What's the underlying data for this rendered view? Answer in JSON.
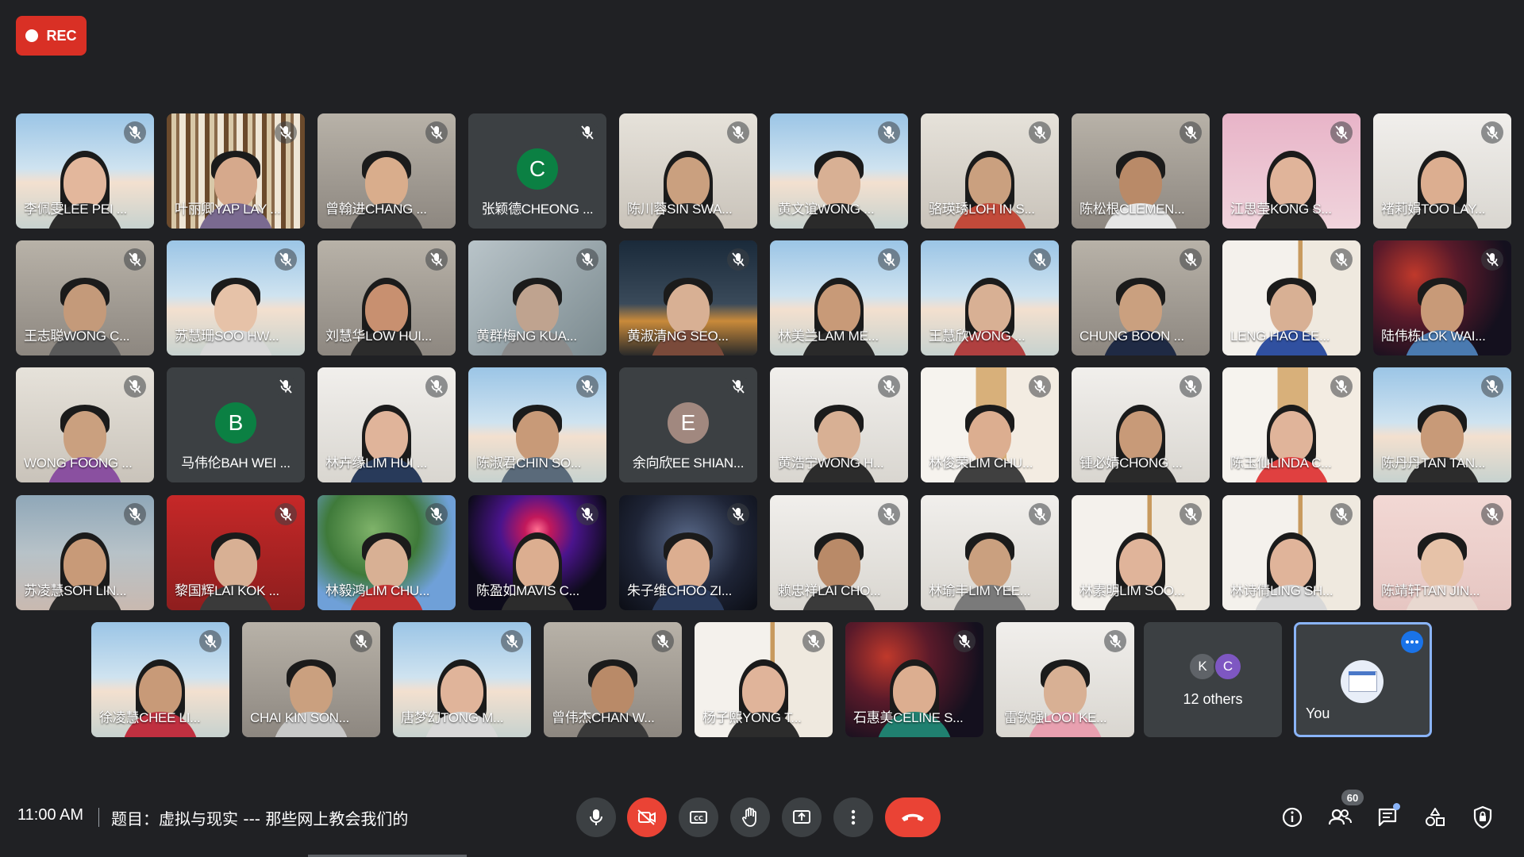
{
  "recording": {
    "label": "REC"
  },
  "participants": [
    {
      "name": "李佩雯LEE PEI ...",
      "kind": "video",
      "bg": "beach",
      "skin": "#e3b79c",
      "shirt": "#2c2c2c",
      "long_hair": true
    },
    {
      "name": "叶丽卿YAP LAY ...",
      "kind": "video",
      "bg": "books",
      "skin": "#d6a98c",
      "shirt": "#7a6a90",
      "long_hair": false
    },
    {
      "name": "曾翰进CHANG ...",
      "kind": "video",
      "bg": "room",
      "skin": "#d9ad8c",
      "shirt": "#3a3a3a",
      "long_hair": false
    },
    {
      "name": "张颖德CHEONG ...",
      "kind": "avatar",
      "letter": "C",
      "avatar_color": "#0b8043"
    },
    {
      "name": "陈川蓉SIN SWA...",
      "kind": "video",
      "bg": "room_light",
      "skin": "#caa07f",
      "shirt": "#2c2c2c",
      "long_hair": true
    },
    {
      "name": "黄文谊WONG ...",
      "kind": "video",
      "bg": "beach",
      "skin": "#d8b094",
      "shirt": "#2a2a2a",
      "long_hair": false
    },
    {
      "name": "骆瑛琇LOH IN S...",
      "kind": "video",
      "bg": "room_light",
      "skin": "#caa07f",
      "shirt": "#c24a3a",
      "long_hair": true
    },
    {
      "name": "陈松根CLEMEN...",
      "kind": "video",
      "bg": "room",
      "skin": "#b98a68",
      "shirt": "#e6e6e6",
      "long_hair": false
    },
    {
      "name": "江思莹KONG S...",
      "kind": "video",
      "bg": "pink",
      "skin": "#e0b49a",
      "shirt": "#2b2b2b",
      "long_hair": true
    },
    {
      "name": "褚莉娟TOO LAY...",
      "kind": "video",
      "bg": "white",
      "skin": "#dcae90",
      "shirt": "#2c2c2c",
      "long_hair": true
    },
    {
      "name": "王志聪WONG C...",
      "kind": "video",
      "bg": "room",
      "skin": "#c49a7a",
      "shirt": "#5a5a5a",
      "long_hair": false
    },
    {
      "name": "苏慧珊SOO HW...",
      "kind": "video",
      "bg": "beach",
      "skin": "#e6c2a8",
      "shirt": "#d8d8d8",
      "long_hair": false
    },
    {
      "name": "刘慧华LOW HUI...",
      "kind": "video",
      "bg": "room",
      "skin": "#c89070",
      "shirt": "#2c2c2c",
      "long_hair": true
    },
    {
      "name": "黄群梅NG KUA...",
      "kind": "video",
      "bg": "blur",
      "skin": "#bfa38f",
      "shirt": "#8a8a8a",
      "long_hair": false
    },
    {
      "name": "黄淑清NG SEO...",
      "kind": "video",
      "bg": "night",
      "skin": "#d8b094",
      "shirt": "#7a4a3a",
      "long_hair": false
    },
    {
      "name": "林美兰LAM ME...",
      "kind": "video",
      "bg": "beach",
      "skin": "#c89a78",
      "shirt": "#2a2a2a",
      "long_hair": true
    },
    {
      "name": "王慧欣WONG ...",
      "kind": "video",
      "bg": "beach",
      "skin": "#d8b094",
      "shirt": "#b04040",
      "long_hair": true
    },
    {
      "name": "CHUNG BOON ...",
      "kind": "video",
      "bg": "room",
      "skin": "#caa07f",
      "shirt": "#1f2a44",
      "long_hair": false
    },
    {
      "name": "LENG HAO EE...",
      "kind": "video",
      "bg": "shelf",
      "skin": "#d8b094",
      "shirt": "#3050a0",
      "long_hair": false
    },
    {
      "name": "陆伟栋LOK WAI...",
      "kind": "video",
      "bg": "space",
      "skin": "#c89a78",
      "shirt": "#4a7ab0",
      "long_hair": false
    },
    {
      "name": "WONG FOONG ...",
      "kind": "video",
      "bg": "room_light",
      "skin": "#caa07f",
      "shirt": "#8a50a0",
      "long_hair": false
    },
    {
      "name": "马伟伦BAH WEI ...",
      "kind": "avatar",
      "letter": "B",
      "avatar_color": "#0b8043"
    },
    {
      "name": "林卉缘LIM HUI ...",
      "kind": "video",
      "bg": "white",
      "skin": "#e0b49a",
      "shirt": "#283a5a",
      "long_hair": true
    },
    {
      "name": "陈淑君CHIN SO...",
      "kind": "video",
      "bg": "beach",
      "skin": "#c89a78",
      "shirt": "#5a6a7a",
      "long_hair": false
    },
    {
      "name": "余向欣EE SHIAN...",
      "kind": "avatar",
      "letter": "E",
      "avatar_color": "#a1887f"
    },
    {
      "name": "黄浩宁WONG H...",
      "kind": "video",
      "bg": "white",
      "skin": "#d8b094",
      "shirt": "#2c2c2c",
      "long_hair": false
    },
    {
      "name": "林俊荣LIM CHU...",
      "kind": "video",
      "bg": "wood",
      "skin": "#dcae90",
      "shirt": "#404040",
      "long_hair": false
    },
    {
      "name": "锺必婧CHONG ...",
      "kind": "video",
      "bg": "white",
      "skin": "#c89a78",
      "shirt": "#2a2a2a",
      "long_hair": true
    },
    {
      "name": "陈玉仙LINDA C...",
      "kind": "video",
      "bg": "wood",
      "skin": "#e0b49a",
      "shirt": "#e04040",
      "long_hair": true
    },
    {
      "name": "陈丹丹TAN TAN...",
      "kind": "video",
      "bg": "beach",
      "skin": "#c89a78",
      "shirt": "#2c2c2c",
      "long_hair": false
    },
    {
      "name": "苏凌慧SOH LIN...",
      "kind": "video",
      "bg": "beach_dim",
      "skin": "#c89a78",
      "shirt": "#2a2a2a",
      "long_hair": true
    },
    {
      "name": "黎国辉LAI KOK ...",
      "kind": "video",
      "bg": "red",
      "skin": "#d8b094",
      "shirt": "#3a3a3a",
      "long_hair": false
    },
    {
      "name": "林毅鸿LIM CHU...",
      "kind": "video",
      "bg": "tree",
      "skin": "#d8b094",
      "shirt": "#c03030",
      "long_hair": false
    },
    {
      "name": "陈盈如MAVIS C...",
      "kind": "video",
      "bg": "fireworks",
      "skin": "#dcae90",
      "shirt": "#2c2c2c",
      "long_hair": true
    },
    {
      "name": "朱子维CHOO ZI...",
      "kind": "video",
      "bg": "dark",
      "skin": "#dcae90",
      "shirt": "#2a3a5a",
      "long_hair": false
    },
    {
      "name": "赖忠祥LAI CHO...",
      "kind": "video",
      "bg": "white",
      "skin": "#b98a68",
      "shirt": "#3a3a3a",
      "long_hair": false
    },
    {
      "name": "林瑜丰LIM YEE...",
      "kind": "video",
      "bg": "white",
      "skin": "#caa07f",
      "shirt": "#7a7a7a",
      "long_hair": false
    },
    {
      "name": "林素明LIM SOO...",
      "kind": "video",
      "bg": "shelf",
      "skin": "#e0b49a",
      "shirt": "#2c2c2c",
      "long_hair": true
    },
    {
      "name": "林诗倩LING SH...",
      "kind": "video",
      "bg": "shelf",
      "skin": "#e0b49a",
      "shirt": "#d8d8d8",
      "long_hair": true
    },
    {
      "name": "陈靖轩TAN JIN...",
      "kind": "video",
      "bg": "pinkwall",
      "skin": "#e6c2a8",
      "shirt": "#e8d8d0",
      "long_hair": false
    },
    {
      "name": "徐凌慧CHEE LI...",
      "kind": "video",
      "bg": "beach",
      "skin": "#c89a78",
      "shirt": "#c03040",
      "long_hair": true
    },
    {
      "name": "CHAI KIN SON...",
      "kind": "video",
      "bg": "room",
      "skin": "#caa07f",
      "shirt": "#c8c8c8",
      "long_hair": false
    },
    {
      "name": "唐梦幻TONG M...",
      "kind": "video",
      "bg": "beach",
      "skin": "#e0b49a",
      "shirt": "#d8d8d8",
      "long_hair": true
    },
    {
      "name": "曾伟杰CHAN W...",
      "kind": "video",
      "bg": "room",
      "skin": "#b98a68",
      "shirt": "#3a3a3a",
      "long_hair": false
    },
    {
      "name": "杨子熙YONG T...",
      "kind": "video",
      "bg": "shelf",
      "skin": "#e0b49a",
      "shirt": "#2c2c2c",
      "long_hair": true
    },
    {
      "name": "石惠美CELINE S...",
      "kind": "video",
      "bg": "space",
      "skin": "#dcae90",
      "shirt": "#208070",
      "long_hair": true
    },
    {
      "name": "雷钦强LOOI KE...",
      "kind": "video",
      "bg": "white",
      "skin": "#d8b094",
      "shirt": "#e8a0b0",
      "long_hair": false
    }
  ],
  "others": {
    "label": "12 others",
    "avatars": [
      {
        "letter": "K",
        "color": "#5f6368"
      },
      {
        "letter": "C",
        "color": "#7e57c2"
      }
    ]
  },
  "self_tile": {
    "label": "You"
  },
  "bottom_bar": {
    "time": "11:00 AM",
    "meeting_title": "题目：虚拟与现实 --- 那些网上教会我们的",
    "participant_count": "60",
    "controls": [
      {
        "name": "mic-button",
        "icon": "mic-icon"
      },
      {
        "name": "camera-off-button",
        "icon": "video-off-icon"
      },
      {
        "name": "captions-button",
        "icon": "cc-icon"
      },
      {
        "name": "raise-hand-button",
        "icon": "hand-icon"
      },
      {
        "name": "present-button",
        "icon": "present-icon"
      },
      {
        "name": "more-options-button",
        "icon": "more-vert-icon"
      },
      {
        "name": "leave-call-button",
        "icon": "end-call-icon"
      }
    ],
    "right_controls": [
      {
        "name": "meeting-details-button",
        "icon": "info-icon"
      },
      {
        "name": "people-button",
        "icon": "people-icon"
      },
      {
        "name": "chat-button",
        "icon": "chat-icon"
      },
      {
        "name": "activities-button",
        "icon": "shapes-icon"
      },
      {
        "name": "host-controls-button",
        "icon": "shield-lock-icon"
      }
    ]
  },
  "colors": {
    "background": "#202124",
    "tile": "#3c4043",
    "accent": "#8ab4f8",
    "danger": "#ea4335"
  }
}
